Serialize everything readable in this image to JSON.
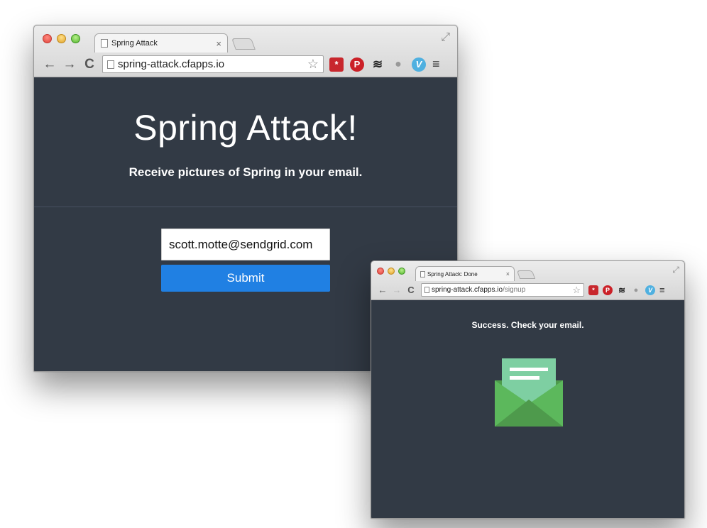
{
  "main_window": {
    "tab": {
      "title": "Spring Attack",
      "close_glyph": "×"
    },
    "toolbar": {
      "back_glyph": "←",
      "forward_glyph": "→",
      "reload_glyph": "C",
      "url": "spring-attack.cfapps.io",
      "star_glyph": "☆",
      "menu_glyph": "≡"
    },
    "extensions": [
      {
        "name": "lastpass-icon",
        "glyph": "*"
      },
      {
        "name": "pinterest-icon",
        "glyph": "P"
      },
      {
        "name": "buffer-icon",
        "glyph": "≋"
      },
      {
        "name": "speech-bubble-icon",
        "glyph": "●"
      },
      {
        "name": "vimeo-icon",
        "glyph": "V"
      }
    ],
    "page": {
      "title": "Spring Attack!",
      "subtitle": "Receive pictures of Spring in your email.",
      "email_value": "scott.motte@sendgrid.com",
      "submit_label": "Submit"
    }
  },
  "done_window": {
    "tab": {
      "title": "Spring Attack: Done",
      "close_glyph": "×"
    },
    "toolbar": {
      "back_glyph": "←",
      "forward_glyph": "→",
      "reload_glyph": "C",
      "url_host": "spring-attack.cfapps.io",
      "url_path": "/signup",
      "star_glyph": "☆",
      "menu_glyph": "≡"
    },
    "page": {
      "message": "Success. Check your email."
    }
  },
  "colors": {
    "page_background": "#323a45",
    "submit_button": "#2080e3",
    "envelope_back": "#4e9a4c",
    "envelope_front": "#5cb85c",
    "envelope_letter": "#7ecfa2"
  }
}
